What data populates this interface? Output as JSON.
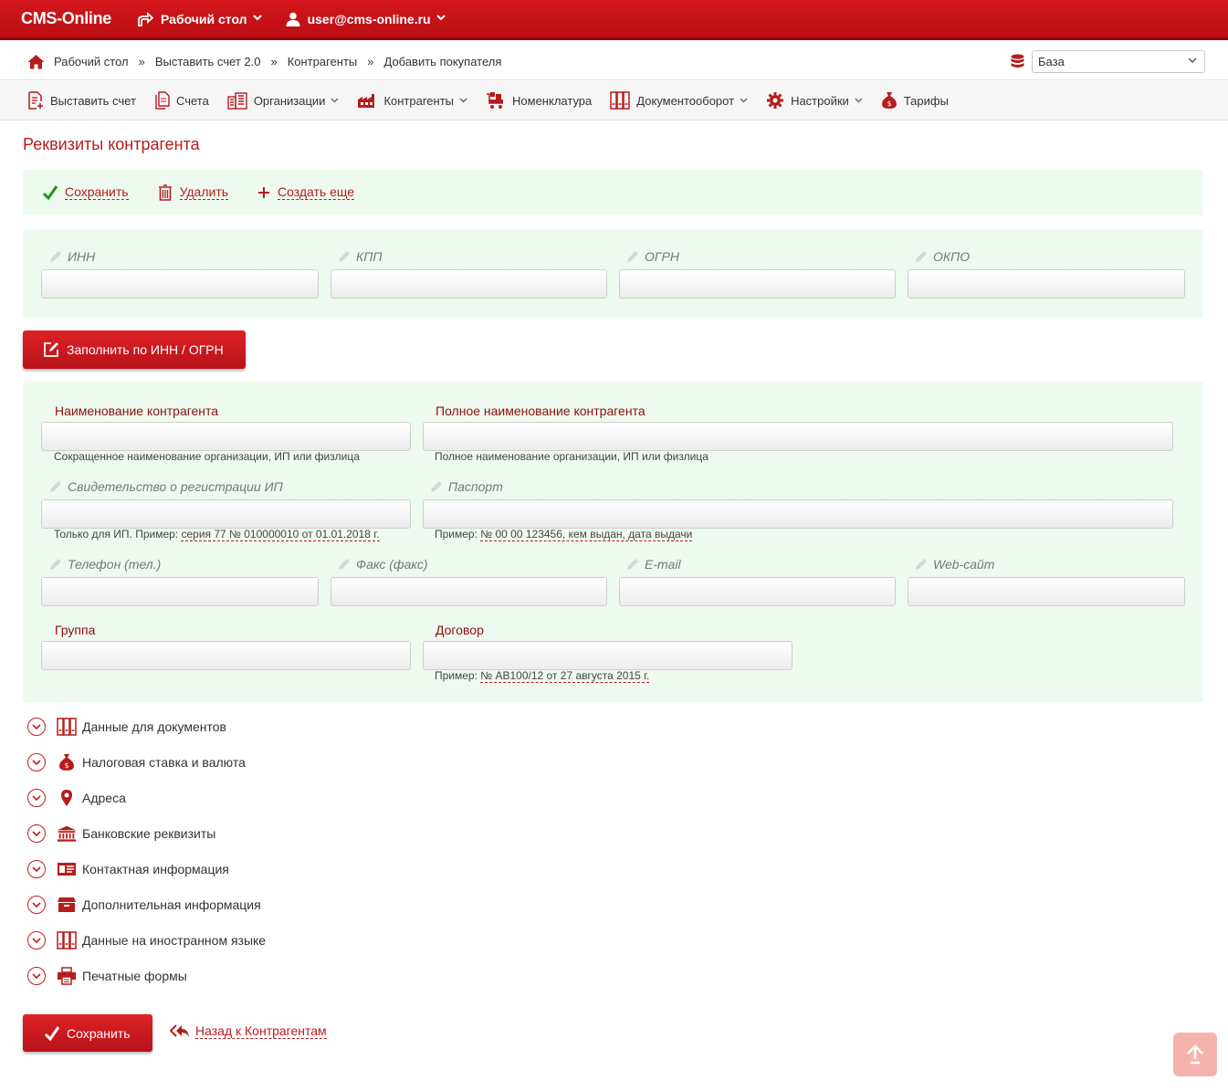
{
  "topbar": {
    "brand": "CMS-Online",
    "desktop_label": "Рабочий стол",
    "user_label": "user@cms-online.ru"
  },
  "breadcrumbs": [
    "Рабочий стол",
    "Выставить счет 2.0",
    "Контрагенты",
    "Добавить покупателя"
  ],
  "breadcrumb_sep": "»",
  "database": {
    "selected": "База"
  },
  "menu": {
    "items": [
      {
        "label": "Выставить счет",
        "icon": "invoice-icon",
        "dropdown": false
      },
      {
        "label": "Счета",
        "icon": "documents-icon",
        "dropdown": false
      },
      {
        "label": "Организации",
        "icon": "building-icon",
        "dropdown": true
      },
      {
        "label": "Контрагенты",
        "icon": "factory-icon",
        "dropdown": true
      },
      {
        "label": "Номенклатура",
        "icon": "cart-icon",
        "dropdown": false
      },
      {
        "label": "Документооборот",
        "icon": "binders-icon",
        "dropdown": true
      },
      {
        "label": "Настройки",
        "icon": "gear-icon",
        "dropdown": true
      },
      {
        "label": "Тарифы",
        "icon": "money-bag-icon",
        "dropdown": false
      }
    ]
  },
  "page_title": "Реквизиты контрагента",
  "actions": {
    "save": "Сохранить",
    "delete": "Удалить",
    "create_more": "Создать еще"
  },
  "codes": {
    "inn": "ИНН",
    "kpp": "КПП",
    "ogrn": "ОГРН",
    "okpo": "ОКПО"
  },
  "fill_button": "Заполнить по ИНН / ОГРН",
  "form": {
    "name_label": "Наименование контрагента",
    "name_hint": "Сокращенное наименование организации, ИП или физлица",
    "fullname_label": "Полное наименование контрагента",
    "fullname_hint": "Полное наименование организации, ИП или физлица",
    "cert_label": "Свидетельство о регистрации ИП",
    "cert_hint_prefix": "Только для ИП. Пример:",
    "cert_hint_example": "серия 77 № 010000010 от 01.01.2018 г.",
    "passport_label": "Паспорт",
    "passport_hint_prefix": "Пример:",
    "passport_hint_example": "№ 00 00 123456, кем выдан, дата выдачи",
    "phone_label": "Телефон (тел.)",
    "fax_label": "Факс (факс)",
    "email_label": "E-mail",
    "web_label": "Web-сайт",
    "group_label": "Группа",
    "contract_label": "Договор",
    "contract_hint_prefix": "Пример:",
    "contract_hint_example": "№ АВ100/12 от 27 августа 2015 г."
  },
  "sections": [
    {
      "label": "Данные для документов",
      "icon": "binders-icon"
    },
    {
      "label": "Налоговая ставка и валюта",
      "icon": "money-bag-icon"
    },
    {
      "label": "Адреса",
      "icon": "map-pin-icon"
    },
    {
      "label": "Банковские реквизиты",
      "icon": "bank-icon"
    },
    {
      "label": "Контактная информация",
      "icon": "contact-card-icon"
    },
    {
      "label": "Дополнительная информация",
      "icon": "archive-box-icon"
    },
    {
      "label": "Данные на иностранном языке",
      "icon": "binders-icon"
    },
    {
      "label": "Печатные формы",
      "icon": "printer-icon"
    }
  ],
  "bottom": {
    "save": "Сохранить",
    "back": "Назад к Контрагентам"
  },
  "colors": {
    "brand_red": "#c8141a",
    "panel_bg": "#eefaef",
    "link_red": "#b71c1c"
  }
}
